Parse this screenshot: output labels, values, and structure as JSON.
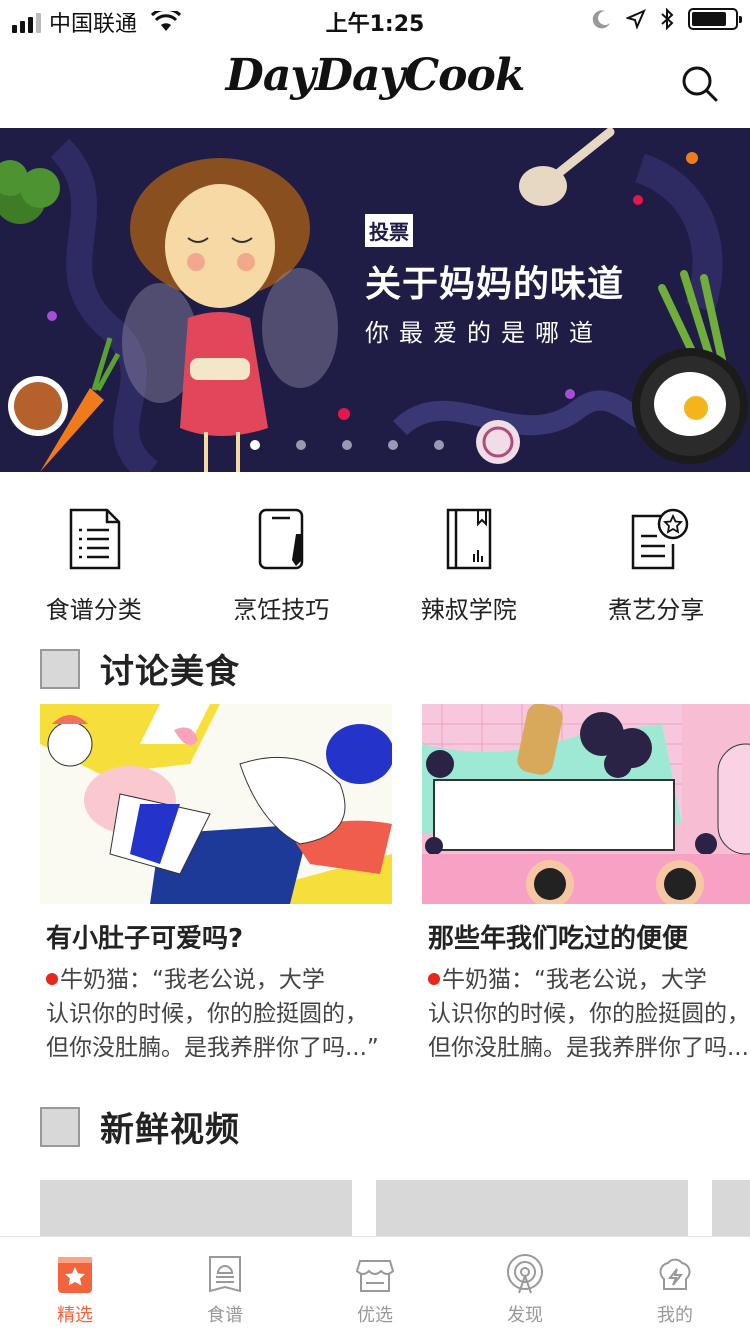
{
  "status_bar": {
    "carrier": "中国联通",
    "time": "上午1:25"
  },
  "header": {
    "logo": "DayDayCook",
    "search_icon": "search-icon"
  },
  "banner": {
    "tag": "投票",
    "title": "关于妈妈的味道",
    "subtitle": "你最爱的是哪道",
    "page_count": 5,
    "active_page": 1
  },
  "categories": [
    {
      "label": "食谱分类",
      "icon": "recipe-list-icon"
    },
    {
      "label": "烹饪技巧",
      "icon": "cutting-board-icon"
    },
    {
      "label": "辣叔学院",
      "icon": "book-icon"
    },
    {
      "label": "煮艺分享",
      "icon": "share-star-icon"
    }
  ],
  "discussion": {
    "title": "讨论美食",
    "cards": [
      {
        "title": "有小肚子可爱吗?",
        "line1": "牛奶猫：“我老公说，大学",
        "line2": "认识你的时候，你的脸挺圆的，",
        "line3": "但你没肚腩。是我养胖你了吗...”"
      },
      {
        "title": "那些年我们吃过的便便",
        "line1": "牛奶猫：“我老公说，大学",
        "line2": "认识你的时候，你的脸挺圆的，",
        "line3": "但你没肚腩。是我养胖你了吗..."
      }
    ]
  },
  "videos": {
    "title": "新鲜视频"
  },
  "tab_bar": {
    "tabs": [
      {
        "label": "精选",
        "icon": "featured-icon",
        "active": true
      },
      {
        "label": "食谱",
        "icon": "recipe-icon",
        "active": false
      },
      {
        "label": "优选",
        "icon": "shop-icon",
        "active": false
      },
      {
        "label": "发现",
        "icon": "discover-icon",
        "active": false
      },
      {
        "label": "我的",
        "icon": "profile-icon",
        "active": false
      }
    ]
  },
  "colors": {
    "accent": "#f3643c",
    "banner_bg": "#1f1d45",
    "placeholder": "#d8d8d8"
  }
}
